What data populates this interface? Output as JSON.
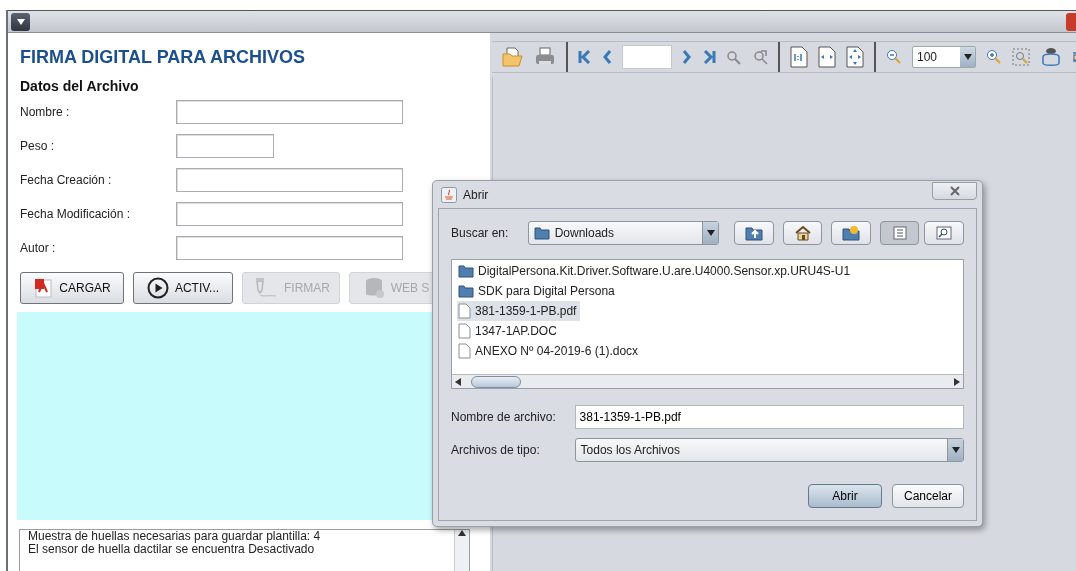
{
  "app": {
    "title": "FIRMA DIGITAL PARA ARCHIVOS",
    "section": "Datos del Archivo",
    "fields": [
      {
        "label": "Nombre :",
        "kind": "wide"
      },
      {
        "label": "Peso :",
        "kind": "short"
      },
      {
        "label": "Fecha Creación :",
        "kind": "wide"
      },
      {
        "label": "Fecha Modificación :",
        "kind": "wide"
      },
      {
        "label": "Autor :",
        "kind": "wide"
      }
    ],
    "buttons": [
      {
        "label": "CARGAR",
        "kind": "pdf",
        "disabled": false
      },
      {
        "label": "ACTIV...",
        "kind": "play",
        "disabled": false
      },
      {
        "label": "FIRMAR",
        "kind": "pen",
        "disabled": true
      },
      {
        "label": "WEB S",
        "kind": "database",
        "disabled": true
      }
    ],
    "log": [
      "Muestra de huellas necesarias para guardar plantilla: 4",
      "El sensor de huella dactilar se encuentra Desactivado"
    ]
  },
  "viewer": {
    "zoom": "100"
  },
  "dialog": {
    "title": "Abrir",
    "look_in_label": "Buscar en:",
    "look_in": "Downloads",
    "tools": [
      {
        "kind": "up",
        "selected": false
      },
      {
        "kind": "home",
        "selected": false
      },
      {
        "kind": "new-folder",
        "selected": false
      },
      {
        "kind": "list",
        "selected": true
      },
      {
        "kind": "details",
        "selected": false
      }
    ],
    "files": [
      {
        "name": "DigitalPersona.Kit.Driver.Software.U.are.U4000.Sensor.xp.URU4S-U1",
        "kind": "folder",
        "selected": false
      },
      {
        "name": "SDK para Digital Persona",
        "kind": "folder",
        "selected": false
      },
      {
        "name": "381-1359-1-PB.pdf",
        "kind": "file",
        "selected": true
      },
      {
        "name": "1347-1AP.DOC",
        "kind": "file",
        "selected": false
      },
      {
        "name": "ANEXO Nº 04-2019-6 (1).docx",
        "kind": "file",
        "selected": false
      }
    ],
    "file_name_label": "Nombre de archivo:",
    "file_name": "381-1359-1-PB.pdf",
    "file_type_label": "Archivos de tipo:",
    "file_type": "Todos los Archivos",
    "buttons": [
      {
        "label": "Abrir",
        "default": true
      },
      {
        "label": "Cancelar",
        "default": false
      }
    ]
  }
}
